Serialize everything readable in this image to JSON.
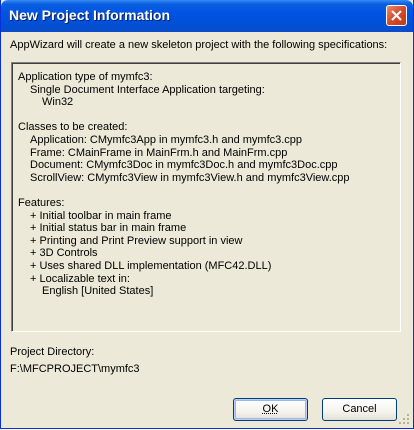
{
  "window": {
    "title": "New Project Information",
    "close_icon": "close-icon"
  },
  "intro": "AppWizard will create a new skeleton project with the following specifications:",
  "spec": {
    "app_type_heading": "Application type of mymfc3:",
    "app_type_line": "Single Document Interface Application targeting:",
    "platform": "Win32",
    "classes_heading": "Classes to be created:",
    "classes": [
      "Application: CMymfc3App in mymfc3.h and mymfc3.cpp",
      "Frame: CMainFrame in MainFrm.h and MainFrm.cpp",
      "Document: CMymfc3Doc in mymfc3Doc.h and mymfc3Doc.cpp",
      "ScrollView: CMymfc3View in mymfc3View.h and mymfc3View.cpp"
    ],
    "features_heading": "Features:",
    "features": [
      "+ Initial toolbar in main frame",
      "+ Initial status bar in main frame",
      "+ Printing and Print Preview support in view",
      "+ 3D Controls",
      "+ Uses shared DLL implementation (MFC42.DLL)",
      "+ Localizable text in:"
    ],
    "language": "English [United States]"
  },
  "project": {
    "label": "Project Directory:",
    "path": "F:\\MFCPROJECT\\mymfc3"
  },
  "buttons": {
    "ok": "OK",
    "cancel": "Cancel"
  }
}
